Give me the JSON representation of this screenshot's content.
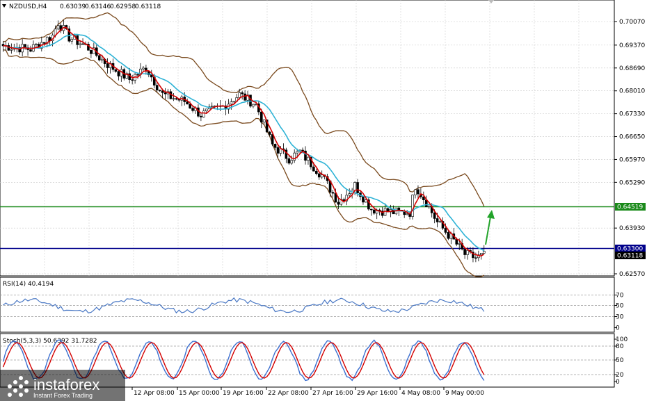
{
  "header": {
    "symbol": "NZDUSD,H4",
    "open": "0.63039",
    "high": "0.63146",
    "low": "0.62958",
    "close": "0.63118"
  },
  "price_axis": {
    "ticks": [
      "0.70070",
      "0.69370",
      "0.68690",
      "0.68010",
      "0.67330",
      "0.66650",
      "0.65970",
      "0.65290",
      "0.64519",
      "0.63930",
      "0.63300",
      "0.63118",
      "0.62570"
    ],
    "green_level": "0.64519",
    "blue_level": "0.63300",
    "current": "0.63118"
  },
  "rsi": {
    "label": "RSI(14) 40.4194",
    "levels": [
      "70",
      "50",
      "30",
      "0"
    ]
  },
  "stoch": {
    "label": "Stoch(5,3,3) 50.6392 31.7282",
    "levels": [
      "100",
      "80",
      "50",
      "20",
      "0"
    ]
  },
  "time_axis": [
    "12 Apr 08:00",
    "15 Apr 00:00",
    "19 Apr 16:00",
    "22 Apr 08:00",
    "27 Apr 16:00",
    "29 Apr 16:00",
    "4 May 08:00",
    "9 May 00:00"
  ],
  "watermark": {
    "brand": "instaforex",
    "tagline": "Instant Forex Trading"
  },
  "colors": {
    "candle_up": "#ffffff",
    "candle_down": "#000000",
    "ma_fast": "#d40000",
    "ma_slow": "#2eb3d6",
    "bollinger": "#7a4a1e",
    "green_line": "#1a8a1a",
    "blue_line": "#00008b",
    "rsi_line": "#4a78c4",
    "stoch_main": "#3b6fd0",
    "stoch_signal": "#d40000",
    "arrow": "#22a32a"
  }
}
